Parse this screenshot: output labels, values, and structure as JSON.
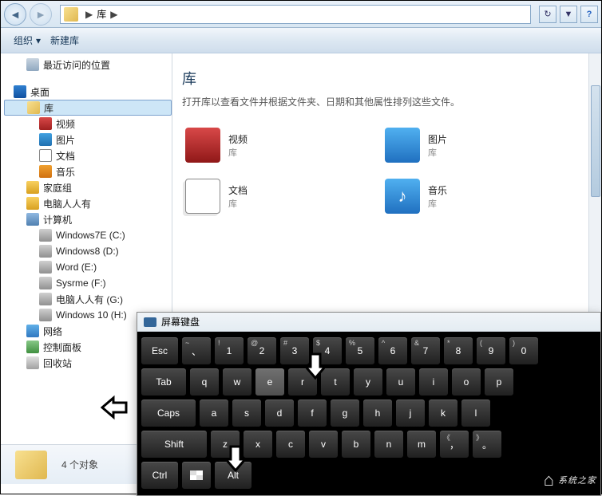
{
  "nav": {
    "path_segment": "库"
  },
  "toolbar": {
    "organize": "组织",
    "new_library": "新建库"
  },
  "sidebar": {
    "recent": "最近访问的位置",
    "desktop": "桌面",
    "library": "库",
    "video": "视频",
    "pictures": "图片",
    "documents": "文档",
    "music": "音乐",
    "homegroup": "家庭组",
    "user": "电脑人人有",
    "computer": "计算机",
    "drives": [
      "Windows7E (C:)",
      "Windows8 (D:)",
      "Word (E:)",
      "Sysrme (F:)",
      "电脑人人有 (G:)",
      "Windows 10 (H:)"
    ],
    "network": "网络",
    "control_panel": "控制面板",
    "recycle_bin": "回收站"
  },
  "content": {
    "title": "库",
    "subtitle": "打开库以查看文件并根据文件夹、日期和其他属性排列这些文件。",
    "items": [
      {
        "name": "视频",
        "sub": "库"
      },
      {
        "name": "图片",
        "sub": "库"
      },
      {
        "name": "文档",
        "sub": "库"
      },
      {
        "name": "音乐",
        "sub": "库"
      }
    ]
  },
  "status": {
    "text": "4 个对象"
  },
  "osk": {
    "title": "屏幕键盘",
    "rows": {
      "r1": [
        {
          "l": "Esc",
          "w": "wide1"
        },
        {
          "l": "、",
          "s": "~"
        },
        {
          "l": "1",
          "s": "!"
        },
        {
          "l": "2",
          "s": "@"
        },
        {
          "l": "3",
          "s": "#"
        },
        {
          "l": "4",
          "s": "$"
        },
        {
          "l": "5",
          "s": "%"
        },
        {
          "l": "6",
          "s": "^"
        },
        {
          "l": "7",
          "s": "&"
        },
        {
          "l": "8",
          "s": "*"
        },
        {
          "l": "9",
          "s": "("
        },
        {
          "l": "0",
          "s": ")"
        }
      ],
      "r2": [
        {
          "l": "Tab",
          "w": "wide2"
        },
        {
          "l": "q"
        },
        {
          "l": "w"
        },
        {
          "l": "e",
          "pressed": true
        },
        {
          "l": "r"
        },
        {
          "l": "t"
        },
        {
          "l": "y"
        },
        {
          "l": "u"
        },
        {
          "l": "i"
        },
        {
          "l": "o"
        },
        {
          "l": "p"
        }
      ],
      "r3": [
        {
          "l": "Caps",
          "w": "wide3"
        },
        {
          "l": "a"
        },
        {
          "l": "s"
        },
        {
          "l": "d"
        },
        {
          "l": "f"
        },
        {
          "l": "g"
        },
        {
          "l": "h"
        },
        {
          "l": "j"
        },
        {
          "l": "k"
        },
        {
          "l": "l"
        }
      ],
      "r4": [
        {
          "l": "Shift",
          "w": "wide4"
        },
        {
          "l": "z"
        },
        {
          "l": "x"
        },
        {
          "l": "c"
        },
        {
          "l": "v"
        },
        {
          "l": "b"
        },
        {
          "l": "n"
        },
        {
          "l": "m"
        },
        {
          "l": "，",
          "s": "《"
        },
        {
          "l": "。",
          "s": "》"
        }
      ],
      "r5": [
        {
          "l": "Ctrl",
          "w": "wide1"
        },
        {
          "l": "",
          "w": "std",
          "win": true
        },
        {
          "l": "Alt",
          "w": "wide1"
        }
      ]
    }
  },
  "watermark": "系统之家"
}
